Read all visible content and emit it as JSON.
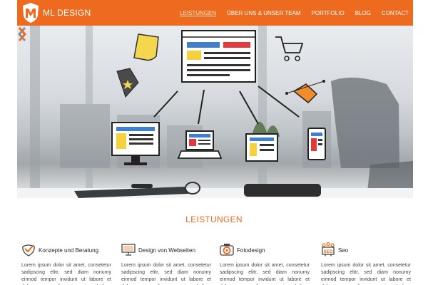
{
  "header": {
    "brand": "ML DESIGN",
    "logo_icon": "ml-shield-logo",
    "nav": [
      {
        "label": "LEISTUNGEN",
        "active": true
      },
      {
        "label": "ÜBER UNS  & UNSER TEAM",
        "active": false
      },
      {
        "label": "PORTFOLIO",
        "active": false
      },
      {
        "label": "BLOG",
        "active": false
      },
      {
        "label": "CONTACT",
        "active": false
      }
    ]
  },
  "hero": {
    "prev_icon": "chevron-left-icon",
    "next_icon": "chevron-right-icon"
  },
  "services_section": {
    "title": "LEISTUNGEN",
    "items": [
      {
        "icon": "check-badge-icon",
        "title": "Konzepte und Beratung",
        "text": "Lorem ipsum dolor sit amet, consetetur sadipscing elitr, sed diam nonumy eirmod tempor invidunt ut labore et dolore magna aliquyam erat, sed diam voluptua. At vero"
      },
      {
        "icon": "monitor-icon",
        "title": "Design von Webseiten",
        "text": "Lorem ipsum dolor sit amet, consetetur sadipscing elitr, sed diam nonumy eirmod tempor invidunt ut labore et dolore magna aliquyam erat, sed diam voluptua. At vero"
      },
      {
        "icon": "camera-icon",
        "title": "Fotodesign",
        "text": "Lorem ipsum dolor sit amet, consetetur sadipscing elitr, sed diam nonumy eirmod tempor invidunt ut labore et dolore magna aliquyam erat, sed diam voluptua. At vero"
      },
      {
        "icon": "seo-icon",
        "icon_label": "SEO",
        "title": "Seo",
        "text": "Lorem ipsum dolor sit amet, consetetur sadipscing elitr, sed diam nonumy eirmod tempor invidunt ut labore et dolore magna aliquyam erat, sed diam voluptua. At vero"
      }
    ]
  },
  "colors": {
    "accent": "#ee6a1e"
  }
}
